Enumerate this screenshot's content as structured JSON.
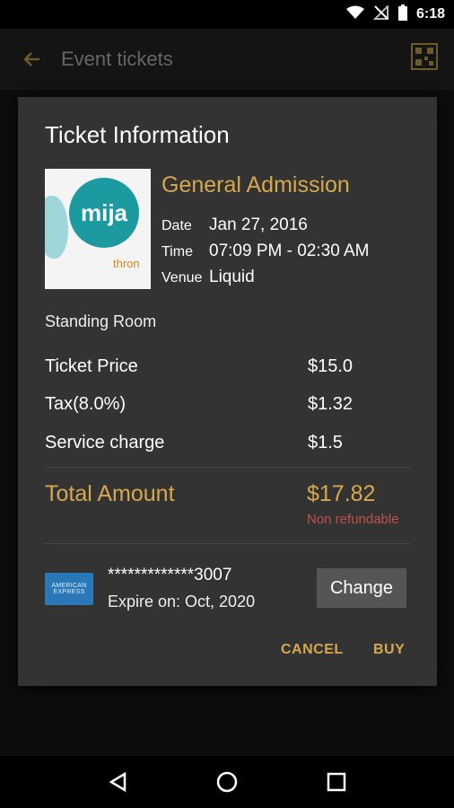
{
  "status_bar": {
    "time": "6:18"
  },
  "app_bar": {
    "title": "Event tickets"
  },
  "dialog": {
    "title": "Ticket Information",
    "poster": {
      "circle_text": "mija",
      "brand_text": "thron"
    },
    "ticket_type": "General Admission",
    "date_label": "Date",
    "date_value": "Jan 27, 2016",
    "time_label": "Time",
    "time_value": "07:09 PM - 02:30 AM",
    "venue_label": "Venue",
    "venue_value": "Liquid",
    "seating": "Standing Room",
    "price_rows": [
      {
        "label": "Ticket Price",
        "value": "$15.0"
      },
      {
        "label": "Tax(8.0%)",
        "value": "$1.32"
      },
      {
        "label": "Service charge",
        "value": "$1.5"
      }
    ],
    "total_label": "Total Amount",
    "total_value": "$17.82",
    "refund_note": "Non refundable",
    "payment": {
      "card_logo_line1": "AMERICAN",
      "card_logo_line2": "EXPRESS",
      "card_number": "*************3007",
      "expiry": "Expire on: Oct, 2020",
      "change_label": "Change"
    },
    "cancel_label": "CANCEL",
    "buy_label": "BUY"
  },
  "colors": {
    "accent": "#d6a84e",
    "warning": "#c0504d",
    "dialog_bg": "#333333",
    "card_blue": "#2a78b8"
  }
}
